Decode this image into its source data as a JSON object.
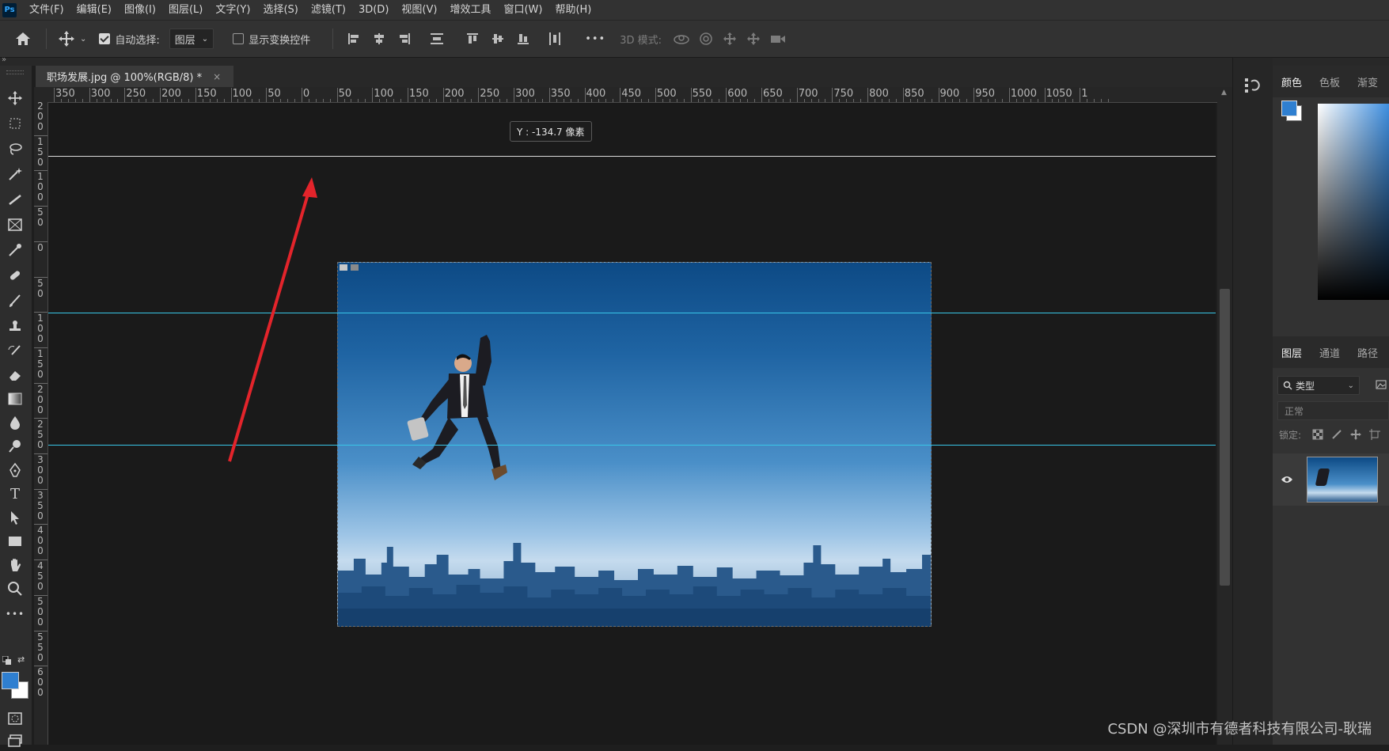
{
  "menu": {
    "logo": "Ps",
    "items": [
      "文件(F)",
      "编辑(E)",
      "图像(I)",
      "图层(L)",
      "文字(Y)",
      "选择(S)",
      "滤镜(T)",
      "3D(D)",
      "视图(V)",
      "增效工具",
      "窗口(W)",
      "帮助(H)"
    ]
  },
  "options": {
    "auto_select_label": "自动选择:",
    "auto_select_checked": true,
    "auto_select_target": "图层",
    "show_transform_label": "显示变换控件",
    "show_transform_checked": false,
    "more_label": "•••",
    "mode_3d_label": "3D 模式:"
  },
  "document": {
    "tab_title": "职场发展.jpg @ 100%(RGB/8) *",
    "close_glyph": "×",
    "zoom": "100%"
  },
  "rulers": {
    "horizontal_labels": [
      "350",
      "300",
      "250",
      "200",
      "150",
      "100",
      "50",
      "0",
      "50",
      "100",
      "150",
      "200",
      "250",
      "300",
      "350",
      "400",
      "450",
      "500",
      "550",
      "600",
      "650",
      "700",
      "750",
      "800",
      "850",
      "900",
      "950",
      "1000",
      "1050",
      "1"
    ],
    "vertical_labels": [
      "200",
      "150",
      "100",
      "50",
      "0",
      "50",
      "100",
      "150",
      "200",
      "250",
      "300",
      "350",
      "400",
      "450",
      "500",
      "550",
      "600"
    ]
  },
  "canvas": {
    "readout": "Y : -134.7 像素",
    "guide_colors": {
      "white": "#d8d8d8",
      "cyan": "#38c6e8"
    },
    "arrow_color": "#e3242b"
  },
  "right_panel": {
    "color_tabs": [
      "颜色",
      "色板",
      "渐变"
    ],
    "active_color_tab": "颜色",
    "foreground_color": "#2f7fd0",
    "background_color": "#ffffff",
    "layer_tabs": [
      "图层",
      "通道",
      "路径"
    ],
    "active_layer_tab": "图层",
    "filter_label": "类型",
    "blend_mode": "正常",
    "lock_label": "锁定:"
  },
  "watermark": "CSDN @深圳市有德者科技有限公司-耿瑞"
}
